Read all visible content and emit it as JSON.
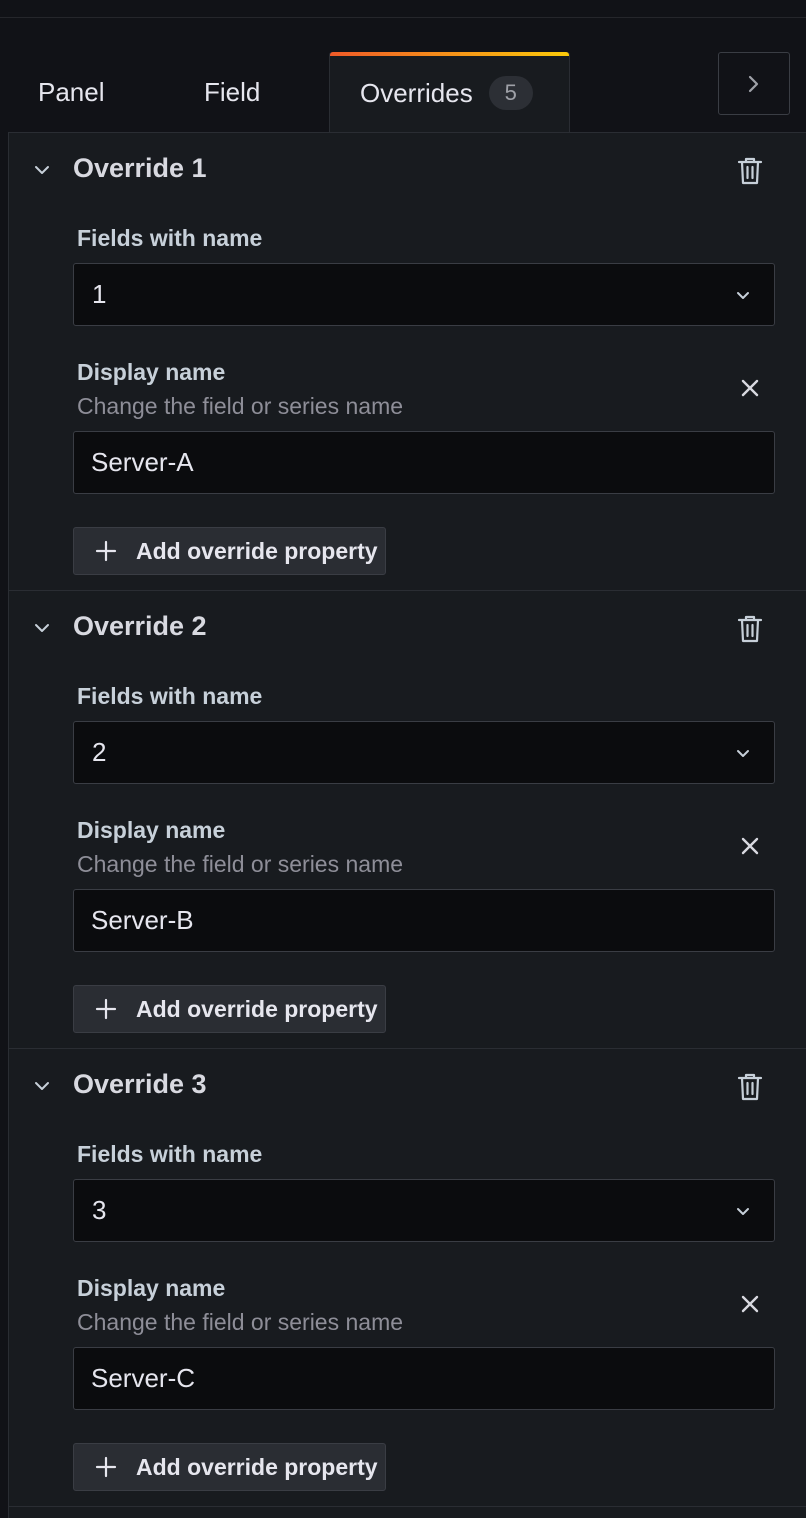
{
  "tabs": {
    "panel_label": "Panel",
    "field_label": "Field",
    "overrides_label": "Overrides",
    "overrides_count": "5"
  },
  "overrides": [
    {
      "title": "Override 1",
      "matcher_label": "Fields with name",
      "matcher_value": "1",
      "property_label": "Display name",
      "property_description": "Change the field or series name",
      "property_value": "Server-A",
      "add_button_label": "Add override property"
    },
    {
      "title": "Override 2",
      "matcher_label": "Fields with name",
      "matcher_value": "2",
      "property_label": "Display name",
      "property_description": "Change the field or series name",
      "property_value": "Server-B",
      "add_button_label": "Add override property"
    },
    {
      "title": "Override 3",
      "matcher_label": "Fields with name",
      "matcher_value": "3",
      "property_label": "Display name",
      "property_description": "Change the field or series name",
      "property_value": "Server-C",
      "add_button_label": "Add override property"
    }
  ],
  "colors": {
    "active_tab_gradient_start": "#f05a28",
    "active_tab_gradient_end": "#fbca0a",
    "background": "#111217",
    "panel_background": "#181b1f"
  },
  "icons": {
    "collapse": "chevron-right-icon",
    "section_toggle": "chevron-down-icon",
    "delete": "trash-icon",
    "remove_property": "close-icon",
    "add": "plus-icon",
    "select_caret": "chevron-down-icon"
  }
}
